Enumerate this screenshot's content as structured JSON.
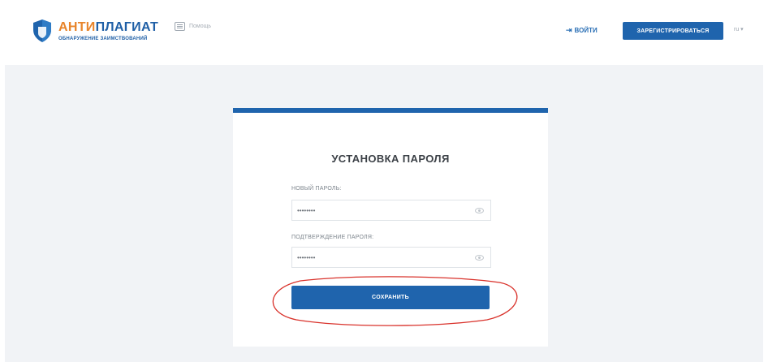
{
  "header": {
    "logo_part1": "АНТИ",
    "logo_part2": "ПЛАГИАТ",
    "logo_subtitle": "ОБНАРУЖЕНИЕ ЗАИМСТВОВАНИЙ",
    "help_label": "Помощь",
    "login_label": "ВОЙТИ",
    "register_label": "ЗАРЕГИСТРИРОВАТЬСЯ",
    "lang_label": "ru ▾"
  },
  "form": {
    "title": "УСТАНОВКА ПАРОЛЯ",
    "new_password_label": "НОВЫЙ ПАРОЛЬ:",
    "new_password_value": "••••••••",
    "confirm_password_label": "ПОДТВЕРЖДЕНИЕ ПАРОЛЯ:",
    "confirm_password_value": "••••••••",
    "save_label": "СОХРАНИТЬ"
  },
  "colors": {
    "accent": "#1f64ad",
    "logo_orange": "#e8842a",
    "page_bg": "#f1f3f6",
    "annotation": "#d9322b"
  },
  "icons": {
    "logo": "shield-logo-icon",
    "help": "document-icon",
    "login": "login-arrow-icon",
    "password_toggle": "eye-icon"
  }
}
